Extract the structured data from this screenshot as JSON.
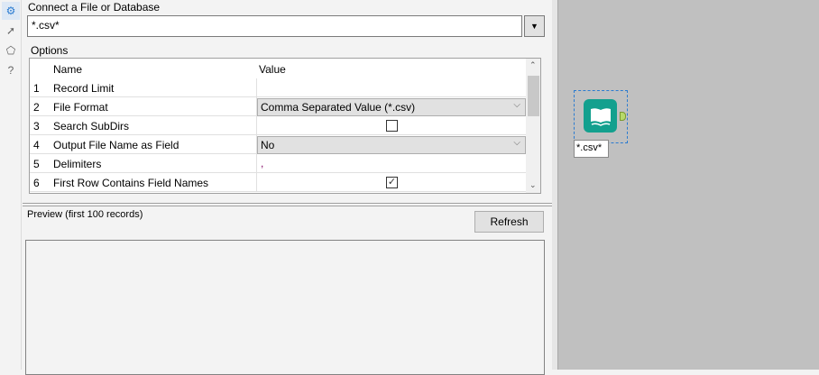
{
  "sidebar_icons": [
    "gear-icon",
    "shortcut-icon",
    "tag-icon",
    "help-icon"
  ],
  "connect": {
    "label": "Connect a File or Database",
    "value": "*.csv*"
  },
  "options": {
    "label": "Options",
    "headers": {
      "name": "Name",
      "value": "Value"
    },
    "rows": [
      {
        "num": "1",
        "name": "Record Limit",
        "value": ""
      },
      {
        "num": "2",
        "name": "File Format",
        "value": "Comma Separated Value (*.csv)"
      },
      {
        "num": "3",
        "name": "Search SubDirs",
        "value": "unchecked"
      },
      {
        "num": "4",
        "name": "Output File Name as Field",
        "value": "No"
      },
      {
        "num": "5",
        "name": "Delimiters",
        "value": ","
      },
      {
        "num": "6",
        "name": "First Row Contains Field Names",
        "value": "checked"
      }
    ]
  },
  "preview": {
    "label": "Preview (first 100 records)",
    "refresh": "Refresh"
  },
  "canvas": {
    "node_label": "*.csv*",
    "node_color": "#13a08e"
  }
}
